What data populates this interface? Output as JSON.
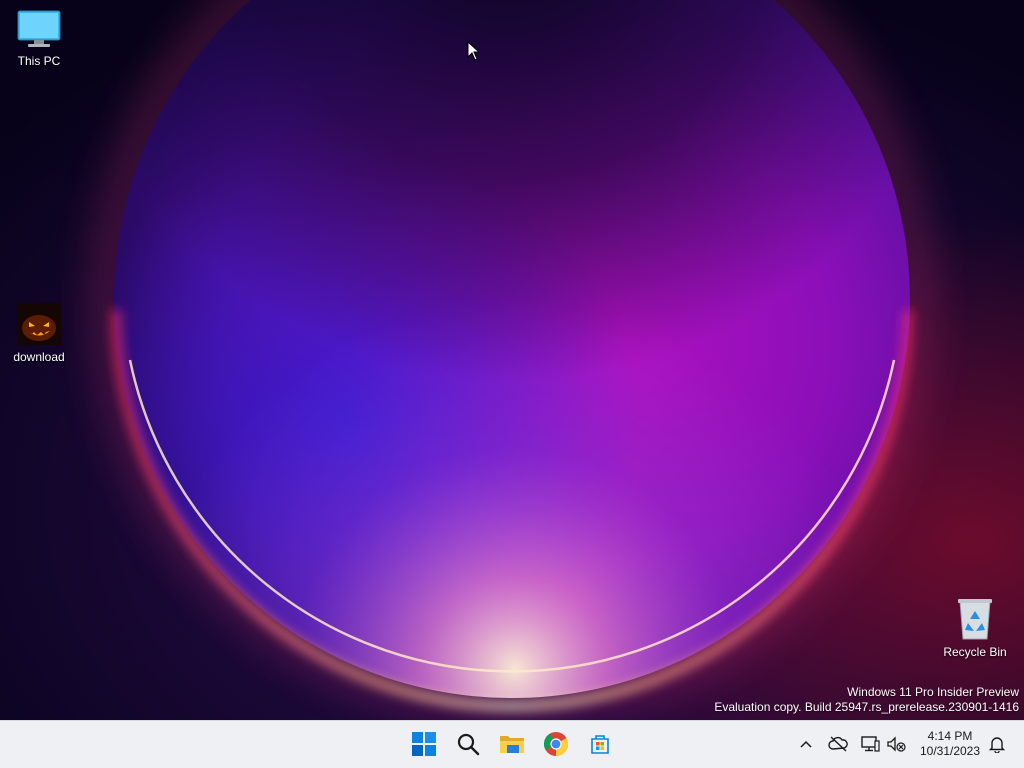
{
  "desktop": {
    "icons": [
      {
        "id": "this-pc",
        "label": "This PC",
        "icon": "monitor-icon"
      },
      {
        "id": "download",
        "label": "download",
        "icon": "pumpkin-image-icon"
      },
      {
        "id": "recycle-bin",
        "label": "Recycle Bin",
        "icon": "recycle-bin-icon"
      }
    ],
    "watermark": {
      "line1": "Windows 11 Pro Insider Preview",
      "line2": "Evaluation copy. Build 25947.rs_prerelease.230901-1416"
    }
  },
  "taskbar": {
    "pinned": [
      {
        "id": "start",
        "icon": "windows-logo-icon",
        "color": "#0078d4"
      },
      {
        "id": "search",
        "icon": "search-icon",
        "color": "#1a1a1a"
      },
      {
        "id": "file-explorer",
        "icon": "folder-icon",
        "color": "#f4c542"
      },
      {
        "id": "chrome",
        "icon": "chrome-icon",
        "color": "#db4437"
      },
      {
        "id": "store",
        "icon": "store-icon",
        "color": "#0078d4"
      }
    ],
    "tray": [
      {
        "id": "show-hidden",
        "icon": "chevron-up-icon"
      },
      {
        "id": "onedrive",
        "icon": "cloud-offline-icon"
      },
      {
        "id": "network",
        "icon": "network-icon"
      },
      {
        "id": "volume",
        "icon": "speaker-muted-icon"
      }
    ],
    "clock": {
      "time": "4:14 PM",
      "date": "10/31/2023"
    },
    "notifications": {
      "icon": "bell-icon"
    }
  },
  "colors": {
    "wallpaper_base": "#0b0420",
    "bloom_center": "#a40cb4",
    "rim_hot": "#ff3d6e",
    "rim_glow": "#ffd9a8",
    "taskbar_bg": "#eef0f3",
    "accent": "#0078d4"
  }
}
